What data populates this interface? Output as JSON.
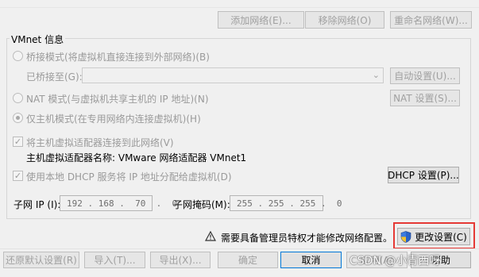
{
  "toolbar": {
    "add_network": "添加网络(E)...",
    "remove_network": "移除网络(O)",
    "rename_network": "重命名网络(W)..."
  },
  "vmnet_info": {
    "group_title": "VMnet 信息",
    "bridged_mode": "桥接模式(将虚拟机直接连接到外部网络)(B)",
    "bridged_to_label": "已桥接至(G):",
    "bridged_to_value": "",
    "auto_settings": "自动设置(U)...",
    "nat_mode": "NAT 模式(与虚拟机共享主机的 IP 地址)(N)",
    "nat_settings": "NAT 设置(S)...",
    "host_only_mode": "仅主机模式(在专用网络内连接虚拟机)(H)",
    "connect_host_adapter": "将主机虚拟适配器连接到此网络(V)",
    "host_adapter_name": "主机虚拟适配器名称: VMware 网络适配器 VMnet1",
    "use_dhcp": "使用本地 DHCP 服务将 IP 地址分配给虚拟机(D)",
    "dhcp_settings": "DHCP 设置(P)...",
    "subnet_ip_label": "子网 IP (I):",
    "subnet_ip_value": "192 . 168 .  70  .  0",
    "subnet_mask_label": "子网掩码(M):",
    "subnet_mask_value": "255 . 255 . 255 .  0"
  },
  "admin_notice": {
    "text": "需要具备管理员特权才能修改网络配置。",
    "change_settings": "更改设置(C)"
  },
  "footer": {
    "restore_defaults": "还原默认设置(R)",
    "import": "导入(T)...",
    "export": "导出(X)...",
    "ok": "确定",
    "cancel": "取消",
    "apply": "应用(A)",
    "help": "帮助"
  },
  "watermark": "CSDN @小青西呀",
  "colors": {
    "accent": "#0078d7",
    "highlight_box": "#e53935",
    "disabled_text": "#a0a0a0"
  }
}
